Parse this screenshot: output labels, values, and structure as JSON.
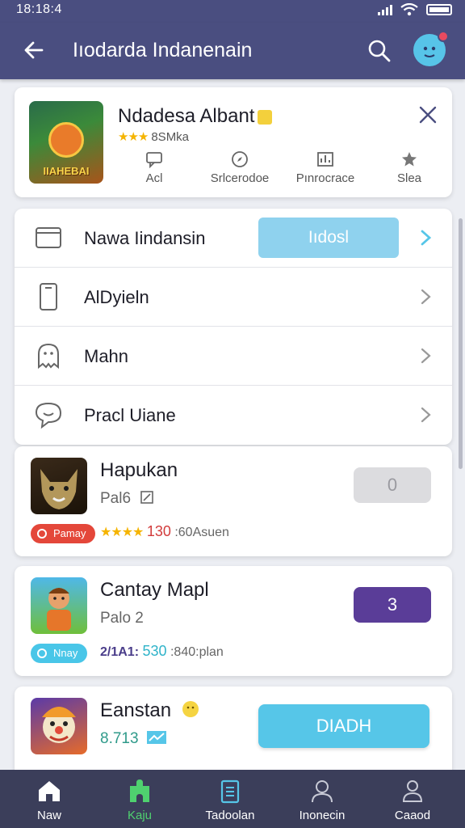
{
  "status": {
    "time": "18:18:4"
  },
  "appbar": {
    "title": "Iıodarda Indanenain"
  },
  "featured": {
    "name": "Ndadesa Albant",
    "thumb_word": "IIAHEBAI",
    "rating_stars": "★★★",
    "rating_text": "8SMka",
    "actions": [
      {
        "label": "Acl",
        "icon": "message-icon"
      },
      {
        "label": "Srlcerodoe",
        "icon": "compass-icon"
      },
      {
        "label": "Pınrocrace",
        "icon": "chart-icon"
      },
      {
        "label": "Slea",
        "icon": "star-icon"
      }
    ]
  },
  "menu": {
    "items": [
      {
        "label": "Nawa Iindansin",
        "icon": "window-icon",
        "cta": "Iıdosl"
      },
      {
        "label": "AlDyieln",
        "icon": "phone-icon"
      },
      {
        "label": "Mahn",
        "icon": "ghost-icon"
      },
      {
        "label": "Pracl Uiane",
        "icon": "chat-heart-icon"
      }
    ]
  },
  "apps": [
    {
      "name": "Hapukan",
      "sub": "Pal6",
      "tag": "Pamay",
      "stars": "★★★★",
      "score": "130",
      "meta": ":60Asuen",
      "button": "0",
      "colors": {
        "tag": "#e4473a",
        "button": "#dcdcdf",
        "score": "#d23c3c"
      }
    },
    {
      "name": "Cantay Mapl",
      "sub": "Palo  2",
      "tag": "Nnay",
      "meta_primary": "2/1A1:",
      "score": "530",
      "meta": ":840:plan",
      "button": "3",
      "colors": {
        "tag": "#49c6e8",
        "button": "#5a3d98",
        "score": "#2fb3c9"
      }
    },
    {
      "name": "Eanstan",
      "sub": "8.713",
      "button": "DIADH",
      "colors": {
        "button": "#56c6e8",
        "sub": "#2f9a8a"
      }
    }
  ],
  "nav": [
    {
      "label": "Naw",
      "icon": "home-icon"
    },
    {
      "label": "Kaju",
      "icon": "puzzle-icon"
    },
    {
      "label": "Tadoolan",
      "icon": "building-icon"
    },
    {
      "label": "Inonecin",
      "icon": "user-group-icon"
    },
    {
      "label": "Caaod",
      "icon": "profile-icon"
    }
  ],
  "colors": {
    "header": "#4a4e80",
    "nav": "#3b3e5a",
    "accent_green": "#4fd16f",
    "accent_cyan": "#56c6e8"
  }
}
